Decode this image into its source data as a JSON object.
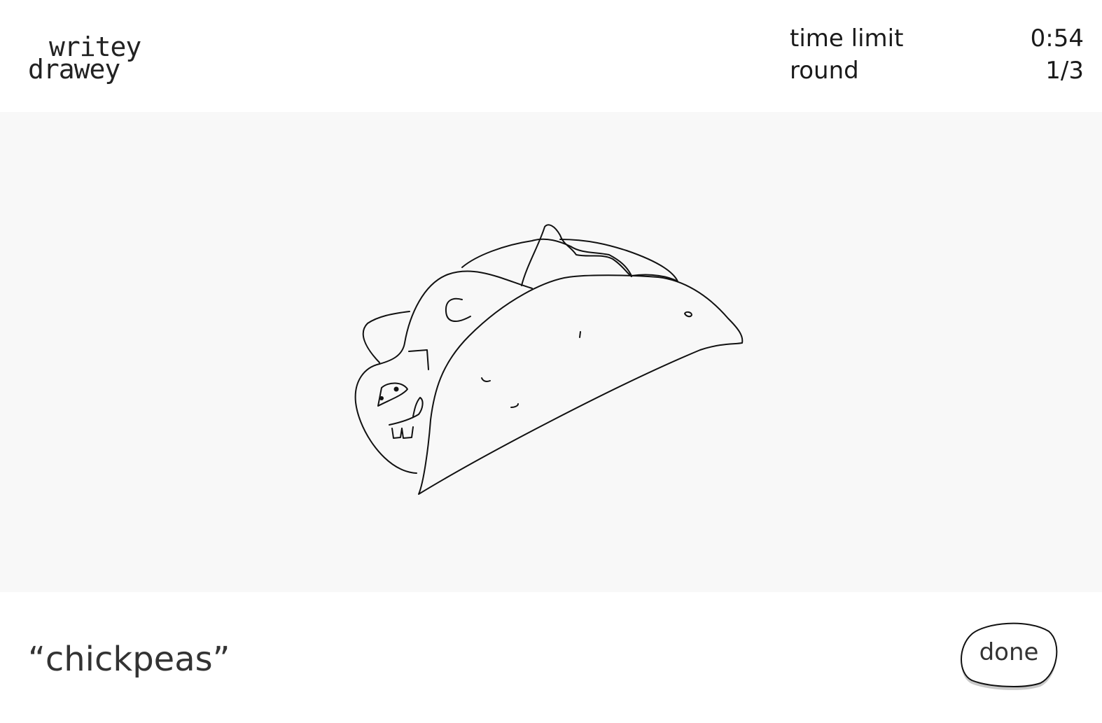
{
  "logo": {
    "line1": "writey",
    "line2": "drawey"
  },
  "stats": {
    "time_limit_label": "time limit",
    "time_limit_value": "0:54",
    "round_label": "round",
    "round_value": "1/3"
  },
  "canvas": {
    "drawing_subject": "taco"
  },
  "prompt": {
    "text": "“chickpeas”"
  },
  "done_button": {
    "label": "done"
  }
}
